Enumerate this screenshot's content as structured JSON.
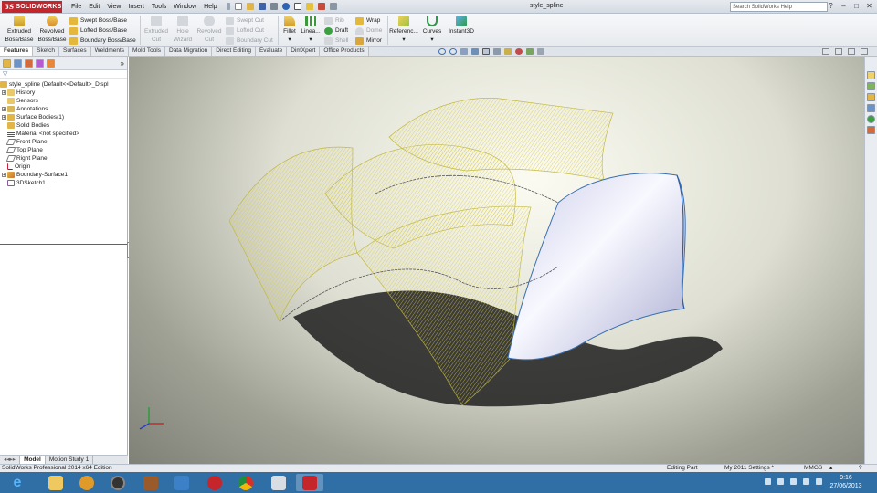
{
  "app": {
    "logo_text": "SOLIDWORKS",
    "document_title": "style_spline",
    "search_placeholder": "Search SolidWorks Help"
  },
  "menu": [
    "File",
    "Edit",
    "View",
    "Insert",
    "Tools",
    "Window",
    "Help"
  ],
  "commands": {
    "extruded_boss": [
      "Extruded",
      "Boss/Base"
    ],
    "revolved_boss": [
      "Revolved",
      "Boss/Base"
    ],
    "swept_boss": "Swept Boss/Base",
    "lofted_boss": "Lofted Boss/Base",
    "boundary_boss": "Boundary Boss/Base",
    "extruded_cut": [
      "Extruded",
      "Cut"
    ],
    "hole_wizard": [
      "Hole",
      "Wizard"
    ],
    "revolved_cut": [
      "Revolved",
      "Cut"
    ],
    "swept_cut": "Swept Cut",
    "lofted_cut": "Lofted Cut",
    "boundary_cut": "Boundary Cut",
    "fillet": "Fillet",
    "linear_pattern": "Linea...",
    "rib": "Rib",
    "draft": "Draft",
    "shell": "Shell",
    "wrap": "Wrap",
    "dome": "Dome",
    "mirror": "Mirror",
    "reference": "Referenc...",
    "curves": "Curves",
    "instant3d": "Instant3D"
  },
  "tabs": [
    "Features",
    "Sketch",
    "Surfaces",
    "Weldments",
    "Mold Tools",
    "Data Migration",
    "Direct Editing",
    "Evaluate",
    "DimXpert",
    "Office Products"
  ],
  "feature_tree": {
    "root": "style_spline  (Default<<Default>_Displ",
    "items": [
      {
        "label": "History",
        "expander": "+"
      },
      {
        "label": "Sensors",
        "expander": ""
      },
      {
        "label": "Annotations",
        "expander": "+"
      },
      {
        "label": "Surface Bodies(1)",
        "expander": "+"
      },
      {
        "label": "Solid Bodies",
        "expander": ""
      },
      {
        "label": "Material <not specified>",
        "expander": ""
      },
      {
        "label": "Front Plane",
        "expander": ""
      },
      {
        "label": "Top Plane",
        "expander": ""
      },
      {
        "label": "Right Plane",
        "expander": ""
      },
      {
        "label": "Origin",
        "expander": ""
      },
      {
        "label": "Boundary-Surface1",
        "expander": "+"
      },
      {
        "label": "3DSketch1",
        "expander": ""
      }
    ]
  },
  "bottom_tabs": [
    "Model",
    "Motion Study 1"
  ],
  "status": {
    "edition": "SolidWorks Professional 2014 x64 Edition",
    "mode": "Editing Part",
    "settings": "My 2011 Settings *",
    "units": "MMGS"
  },
  "taskbar": {
    "time": "9:16",
    "date": "27/06/2013"
  }
}
